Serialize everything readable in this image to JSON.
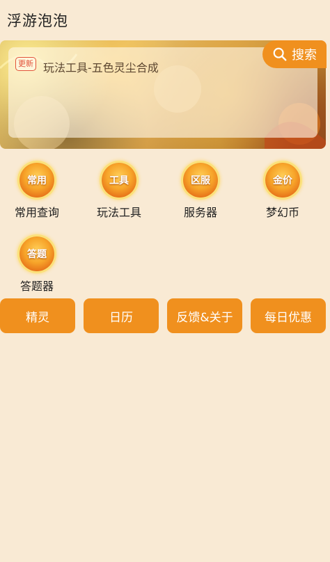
{
  "header": {
    "title": "浮游泡泡"
  },
  "banner": {
    "badge": "更新",
    "text": "玩法工具-五色灵尘合成",
    "search_label": "搜索"
  },
  "menu": [
    {
      "icon_text": "常用",
      "label": "常用查询"
    },
    {
      "icon_text": "工具",
      "label": "玩法工具"
    },
    {
      "icon_text": "区服",
      "label": "服务器"
    },
    {
      "icon_text": "金价",
      "label": "梦幻币"
    },
    {
      "icon_text": "答题",
      "label": "答题器"
    }
  ],
  "actions": [
    {
      "label": "精灵"
    },
    {
      "label": "日历"
    },
    {
      "label": "反馈&关于"
    },
    {
      "label": "每日优惠"
    }
  ],
  "colors": {
    "background": "#f9ead4",
    "accent": "#f0901e",
    "badge": "#e2533a"
  }
}
